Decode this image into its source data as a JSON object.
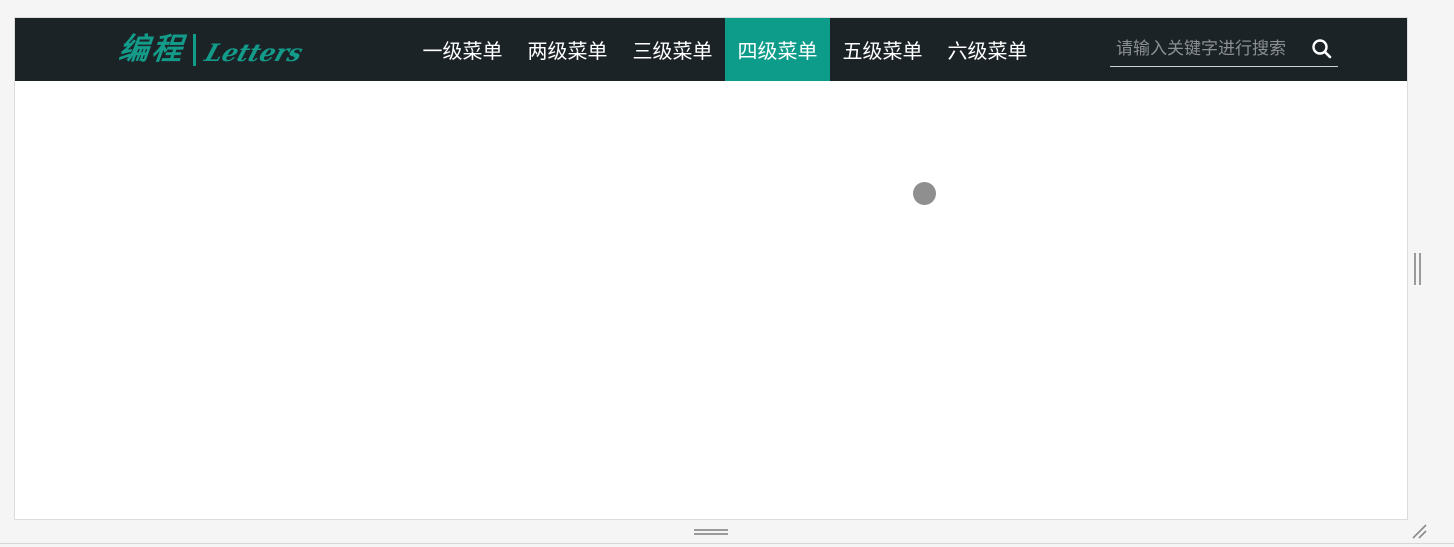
{
  "brand": {
    "logo_cn": "编程",
    "logo_en": "Letters",
    "color": "#139b8a"
  },
  "nav": {
    "items": [
      {
        "label": "一级菜单",
        "active": false
      },
      {
        "label": "两级菜单",
        "active": false
      },
      {
        "label": "三级菜单",
        "active": false
      },
      {
        "label": "四级菜单",
        "active": true
      },
      {
        "label": "五级菜单",
        "active": false
      },
      {
        "label": "六级菜单",
        "active": false
      }
    ],
    "background": "#1c2327",
    "active_color": "#0e9c8a"
  },
  "search": {
    "placeholder": "请输入关键字进行搜索",
    "value": "",
    "icon": "search-icon"
  },
  "content": {
    "loading_indicator": "loading-dot"
  }
}
